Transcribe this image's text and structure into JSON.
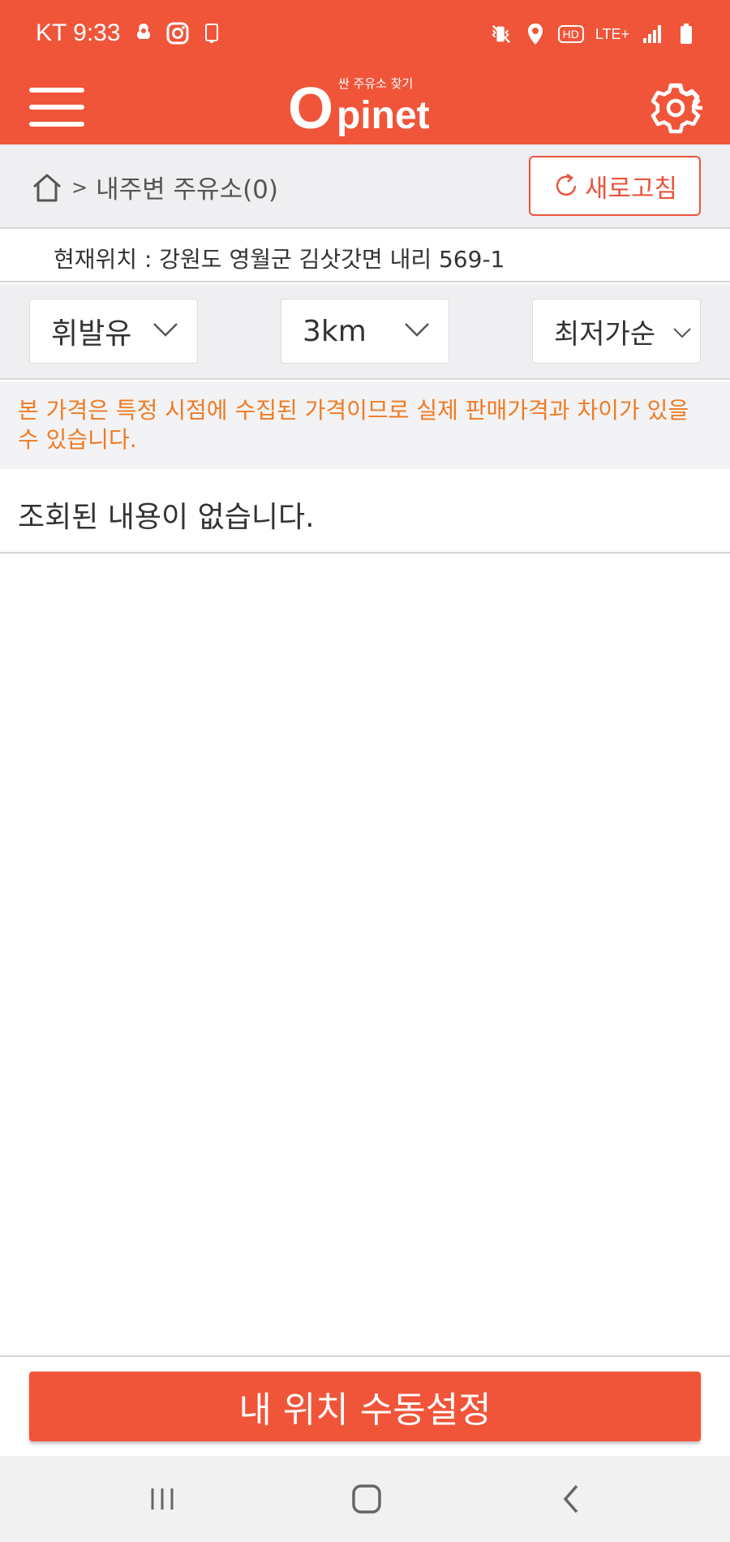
{
  "status_bar": {
    "carrier_time": "KT 9:33",
    "icons_left": [
      "weather-icon",
      "instagram-icon",
      "tablet-icon"
    ],
    "icons_right": [
      "vibrate-icon",
      "location-icon",
      "hd-icon",
      "lte-icon",
      "signal-icon",
      "battery-icon"
    ],
    "hd_label": "HD",
    "lte_label": "LTE+"
  },
  "app_bar": {
    "logo_tagline": "싼 주유소 찾기",
    "logo_o": "O",
    "logo_rest": "pinet",
    "icons": [
      "menu-icon",
      "gear-icon"
    ]
  },
  "breadcrumb": {
    "label": "내주변 주유소(0)",
    "separator": ">",
    "refresh_label": "새로고침"
  },
  "location": {
    "text": "현재위치 : 강원도 영월군 김삿갓면 내리 569-1"
  },
  "filters": {
    "fuel": "휘발유",
    "distance": "3km",
    "sort": "최저가순"
  },
  "notice": {
    "text": "본 가격은 특정 시점에 수집된 가격이므로 실제 판매가격과 차이가 있을 수 있습니다."
  },
  "result": {
    "empty_message": "조회된 내용이 없습니다."
  },
  "bottom": {
    "manual_location_label": "내 위치 수동설정"
  },
  "colors": {
    "brand": "#f0553a",
    "notice": "#f07a22",
    "background_gray": "#efeff2"
  }
}
